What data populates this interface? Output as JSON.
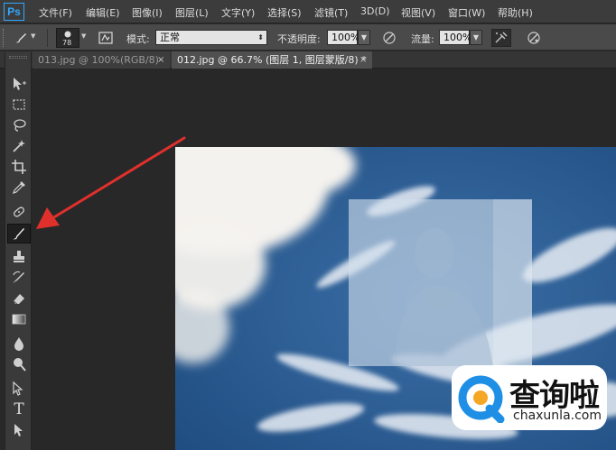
{
  "app": {
    "logo": "Ps"
  },
  "menubar": {
    "items": [
      "文件(F)",
      "编辑(E)",
      "图像(I)",
      "图层(L)",
      "文字(Y)",
      "选择(S)",
      "滤镜(T)",
      "3D(D)",
      "视图(V)",
      "窗口(W)",
      "帮助(H)"
    ]
  },
  "options": {
    "brush_size": "78",
    "mode_label": "模式:",
    "mode_value": "正常",
    "opacity_label": "不透明度:",
    "opacity_value": "100%",
    "flow_label": "流量:",
    "flow_value": "100%",
    "icons": [
      "brush-tool-icon",
      "brush-preset-icon",
      "toggle-brush-panel-icon",
      "pressure-opacity-icon",
      "airbrush-icon",
      "pressure-size-icon"
    ]
  },
  "tabs": [
    {
      "label": "013.jpg @ 100%(RGB/8)",
      "close": "×",
      "active": false
    },
    {
      "label": "012.jpg @ 66.7% (图层 1, 图层蒙版/8) *",
      "close": "×",
      "active": true
    }
  ],
  "toolbar": {
    "tools": [
      "move",
      "rectangular-marquee",
      "lasso",
      "magic-wand",
      "crop",
      "eyedropper",
      "spot-healing-brush",
      "brush",
      "clone-stamp",
      "history-brush",
      "eraser",
      "gradient",
      "blur",
      "dodge",
      "path-selection",
      "type",
      "direct-selection"
    ],
    "active": "brush",
    "type_glyph": "T"
  },
  "canvas": {
    "sky_color": "#2c5c93",
    "cloud_color": "#f4f2ee",
    "overlay_color": "#d2deec"
  },
  "annotation": {
    "arrow_color": "#e0302c"
  },
  "watermark": {
    "title": "查询啦",
    "url": "chaxunla.com",
    "logo_color": "#1f8fe6",
    "accent_color": "#f5a623"
  }
}
